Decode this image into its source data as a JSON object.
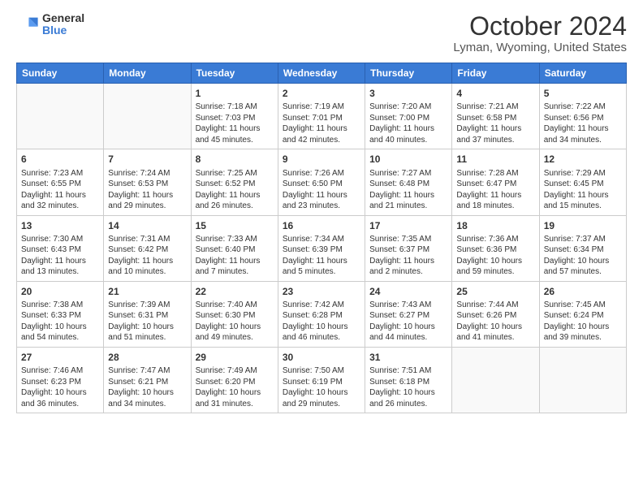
{
  "header": {
    "logo_general": "General",
    "logo_blue": "Blue",
    "title": "October 2024",
    "subtitle": "Lyman, Wyoming, United States"
  },
  "weekdays": [
    "Sunday",
    "Monday",
    "Tuesday",
    "Wednesday",
    "Thursday",
    "Friday",
    "Saturday"
  ],
  "weeks": [
    [
      {
        "day": "",
        "info": ""
      },
      {
        "day": "",
        "info": ""
      },
      {
        "day": "1",
        "info": "Sunrise: 7:18 AM\nSunset: 7:03 PM\nDaylight: 11 hours and 45 minutes."
      },
      {
        "day": "2",
        "info": "Sunrise: 7:19 AM\nSunset: 7:01 PM\nDaylight: 11 hours and 42 minutes."
      },
      {
        "day": "3",
        "info": "Sunrise: 7:20 AM\nSunset: 7:00 PM\nDaylight: 11 hours and 40 minutes."
      },
      {
        "day": "4",
        "info": "Sunrise: 7:21 AM\nSunset: 6:58 PM\nDaylight: 11 hours and 37 minutes."
      },
      {
        "day": "5",
        "info": "Sunrise: 7:22 AM\nSunset: 6:56 PM\nDaylight: 11 hours and 34 minutes."
      }
    ],
    [
      {
        "day": "6",
        "info": "Sunrise: 7:23 AM\nSunset: 6:55 PM\nDaylight: 11 hours and 32 minutes."
      },
      {
        "day": "7",
        "info": "Sunrise: 7:24 AM\nSunset: 6:53 PM\nDaylight: 11 hours and 29 minutes."
      },
      {
        "day": "8",
        "info": "Sunrise: 7:25 AM\nSunset: 6:52 PM\nDaylight: 11 hours and 26 minutes."
      },
      {
        "day": "9",
        "info": "Sunrise: 7:26 AM\nSunset: 6:50 PM\nDaylight: 11 hours and 23 minutes."
      },
      {
        "day": "10",
        "info": "Sunrise: 7:27 AM\nSunset: 6:48 PM\nDaylight: 11 hours and 21 minutes."
      },
      {
        "day": "11",
        "info": "Sunrise: 7:28 AM\nSunset: 6:47 PM\nDaylight: 11 hours and 18 minutes."
      },
      {
        "day": "12",
        "info": "Sunrise: 7:29 AM\nSunset: 6:45 PM\nDaylight: 11 hours and 15 minutes."
      }
    ],
    [
      {
        "day": "13",
        "info": "Sunrise: 7:30 AM\nSunset: 6:43 PM\nDaylight: 11 hours and 13 minutes."
      },
      {
        "day": "14",
        "info": "Sunrise: 7:31 AM\nSunset: 6:42 PM\nDaylight: 11 hours and 10 minutes."
      },
      {
        "day": "15",
        "info": "Sunrise: 7:33 AM\nSunset: 6:40 PM\nDaylight: 11 hours and 7 minutes."
      },
      {
        "day": "16",
        "info": "Sunrise: 7:34 AM\nSunset: 6:39 PM\nDaylight: 11 hours and 5 minutes."
      },
      {
        "day": "17",
        "info": "Sunrise: 7:35 AM\nSunset: 6:37 PM\nDaylight: 11 hours and 2 minutes."
      },
      {
        "day": "18",
        "info": "Sunrise: 7:36 AM\nSunset: 6:36 PM\nDaylight: 10 hours and 59 minutes."
      },
      {
        "day": "19",
        "info": "Sunrise: 7:37 AM\nSunset: 6:34 PM\nDaylight: 10 hours and 57 minutes."
      }
    ],
    [
      {
        "day": "20",
        "info": "Sunrise: 7:38 AM\nSunset: 6:33 PM\nDaylight: 10 hours and 54 minutes."
      },
      {
        "day": "21",
        "info": "Sunrise: 7:39 AM\nSunset: 6:31 PM\nDaylight: 10 hours and 51 minutes."
      },
      {
        "day": "22",
        "info": "Sunrise: 7:40 AM\nSunset: 6:30 PM\nDaylight: 10 hours and 49 minutes."
      },
      {
        "day": "23",
        "info": "Sunrise: 7:42 AM\nSunset: 6:28 PM\nDaylight: 10 hours and 46 minutes."
      },
      {
        "day": "24",
        "info": "Sunrise: 7:43 AM\nSunset: 6:27 PM\nDaylight: 10 hours and 44 minutes."
      },
      {
        "day": "25",
        "info": "Sunrise: 7:44 AM\nSunset: 6:26 PM\nDaylight: 10 hours and 41 minutes."
      },
      {
        "day": "26",
        "info": "Sunrise: 7:45 AM\nSunset: 6:24 PM\nDaylight: 10 hours and 39 minutes."
      }
    ],
    [
      {
        "day": "27",
        "info": "Sunrise: 7:46 AM\nSunset: 6:23 PM\nDaylight: 10 hours and 36 minutes."
      },
      {
        "day": "28",
        "info": "Sunrise: 7:47 AM\nSunset: 6:21 PM\nDaylight: 10 hours and 34 minutes."
      },
      {
        "day": "29",
        "info": "Sunrise: 7:49 AM\nSunset: 6:20 PM\nDaylight: 10 hours and 31 minutes."
      },
      {
        "day": "30",
        "info": "Sunrise: 7:50 AM\nSunset: 6:19 PM\nDaylight: 10 hours and 29 minutes."
      },
      {
        "day": "31",
        "info": "Sunrise: 7:51 AM\nSunset: 6:18 PM\nDaylight: 10 hours and 26 minutes."
      },
      {
        "day": "",
        "info": ""
      },
      {
        "day": "",
        "info": ""
      }
    ]
  ]
}
